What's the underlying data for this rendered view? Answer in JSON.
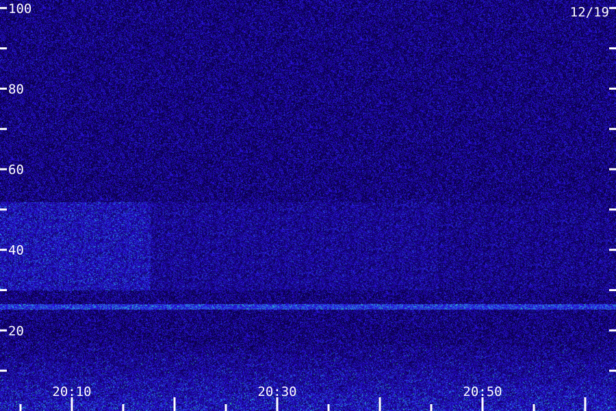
{
  "chart_data": {
    "type": "heatmap",
    "date_label": "12/19",
    "x": {
      "range": [
        "20:03",
        "21:03"
      ],
      "tick_labels": [
        "20:10",
        "20:30",
        "20:50"
      ],
      "minor_tick_minutes": 5
    },
    "y": {
      "range": [
        0,
        102
      ],
      "tick_labels": [
        "20",
        "40",
        "60",
        "80",
        "100"
      ],
      "tick_step": 10
    },
    "grid": false,
    "colors": {
      "background": "#08004a",
      "noise": "#2a12c8",
      "mid": "#2c4cff",
      "high": "#20d0ff",
      "peak": "#40ffa0",
      "label": "#ffffff"
    },
    "features": {
      "horizontal_band_level": 26,
      "broadband_region_levels": [
        30,
        52
      ],
      "active_region_top_level": 18
    }
  }
}
